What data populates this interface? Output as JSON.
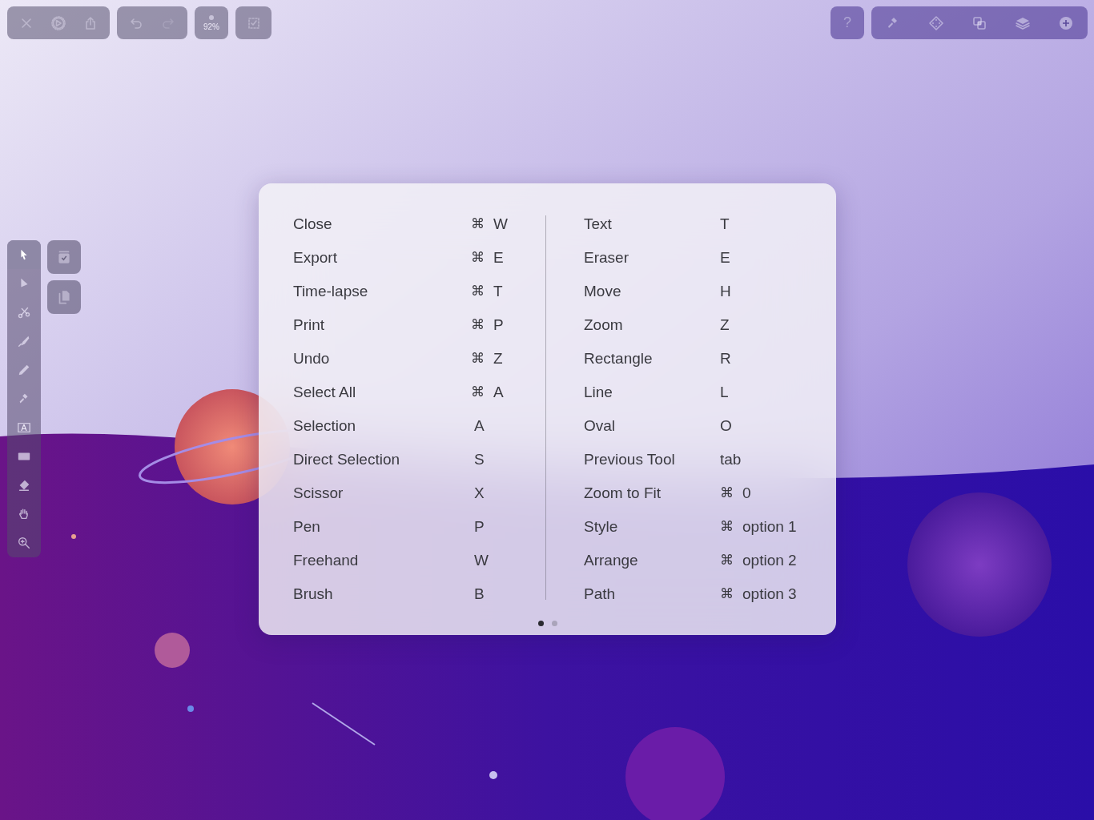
{
  "top_left_toolbar": [
    {
      "buttons": [
        {
          "kind": "close",
          "disabled": false
        },
        {
          "kind": "settings",
          "disabled": false
        },
        {
          "kind": "share",
          "disabled": false
        }
      ]
    },
    {
      "buttons": [
        {
          "kind": "undo",
          "disabled": false
        },
        {
          "kind": "redo",
          "disabled": true
        }
      ]
    }
  ],
  "zoom_button": {
    "label": "92%"
  },
  "select_button": {
    "kind": "select"
  },
  "help_button": {
    "label": "?"
  },
  "top_right_toolbar": [
    {
      "kind": "brush"
    },
    {
      "kind": "diamond"
    },
    {
      "kind": "boolean"
    },
    {
      "kind": "layers"
    },
    {
      "kind": "add"
    }
  ],
  "tools": [
    {
      "kind": "pointer",
      "selected": true
    },
    {
      "kind": "direct",
      "selected": false
    },
    {
      "kind": "scissors",
      "selected": false
    },
    {
      "kind": "pen",
      "selected": false
    },
    {
      "kind": "pencil",
      "selected": false
    },
    {
      "kind": "brush",
      "selected": false
    },
    {
      "kind": "text",
      "label": "A",
      "selected": false
    },
    {
      "kind": "rectangle",
      "selected": false
    },
    {
      "kind": "eraser",
      "selected": false
    },
    {
      "kind": "hand",
      "selected": false
    },
    {
      "kind": "zoom",
      "selected": false
    }
  ],
  "side_buttons": [
    {
      "kind": "selection-box"
    },
    {
      "kind": "duplicate"
    }
  ],
  "shortcuts": {
    "columns": [
      {
        "rows": [
          {
            "label": "Close",
            "modifier": "⌘",
            "key": "W"
          },
          {
            "label": "Export",
            "modifier": "⌘",
            "key": "E"
          },
          {
            "label": "Time-lapse",
            "modifier": "⌘",
            "key": "T"
          },
          {
            "label": "Print",
            "modifier": "⌘",
            "key": "P"
          },
          {
            "label": "Undo",
            "modifier": "⌘",
            "key": "Z"
          },
          {
            "label": "Select All",
            "modifier": "⌘",
            "key": "A"
          },
          {
            "label": "Selection",
            "key": "A"
          },
          {
            "label": "Direct Selection",
            "key": "S"
          },
          {
            "label": "Scissor",
            "key": "X"
          },
          {
            "label": "Pen",
            "key": "P"
          },
          {
            "label": "Freehand",
            "key": "W"
          },
          {
            "label": "Brush",
            "key": "B"
          }
        ]
      },
      {
        "rows": [
          {
            "label": "Text",
            "key": "T"
          },
          {
            "label": "Eraser",
            "key": "E"
          },
          {
            "label": "Move",
            "key": "H"
          },
          {
            "label": "Zoom",
            "key": "Z"
          },
          {
            "label": "Rectangle",
            "key": "R"
          },
          {
            "label": "Line",
            "key": "L"
          },
          {
            "label": "Oval",
            "key": "O"
          },
          {
            "label": "Previous Tool",
            "key": "tab"
          },
          {
            "label": "Zoom to Fit",
            "modifier": "⌘",
            "key": "0"
          },
          {
            "label": "Style",
            "modifier": "⌘",
            "key": "option 1"
          },
          {
            "label": "Arrange",
            "modifier": "⌘",
            "key": "option 2"
          },
          {
            "label": "Path",
            "modifier": "⌘",
            "key": "option 3"
          }
        ]
      }
    ],
    "pages": [
      {
        "selected": true
      },
      {
        "selected": false
      }
    ]
  }
}
